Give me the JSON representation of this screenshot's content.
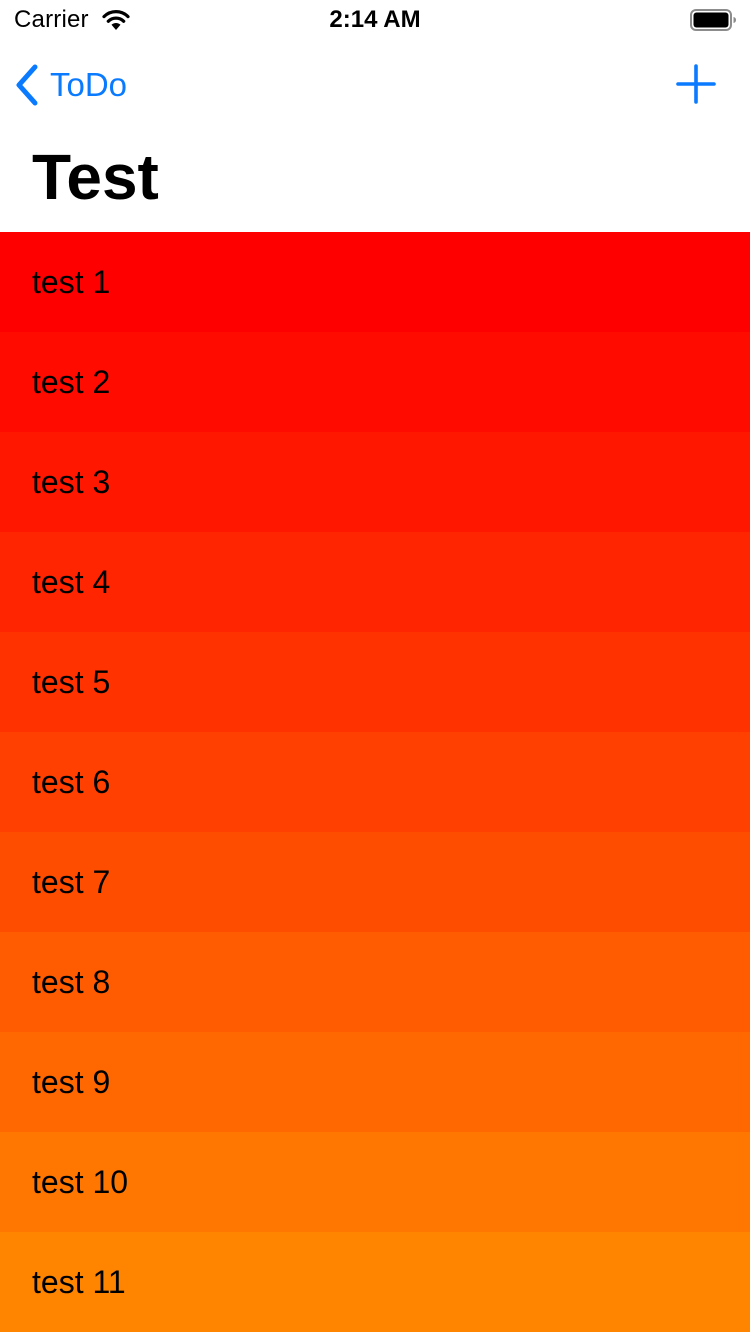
{
  "status_bar": {
    "carrier": "Carrier",
    "time": "2:14 AM"
  },
  "nav": {
    "back_label": "ToDo",
    "back_icon": "chevron-left-icon",
    "add_icon": "plus-icon",
    "accent_color": "#0a7aff"
  },
  "title": "Test",
  "items": [
    {
      "label": "test 1",
      "color": "#ff0000"
    },
    {
      "label": "test 2",
      "color": "#ff0b00"
    },
    {
      "label": "test 3",
      "color": "#ff1700"
    },
    {
      "label": "test 4",
      "color": "#ff2500"
    },
    {
      "label": "test 5",
      "color": "#ff3200"
    },
    {
      "label": "test 6",
      "color": "#ff4000"
    },
    {
      "label": "test 7",
      "color": "#ff4d00"
    },
    {
      "label": "test 8",
      "color": "#ff5b00"
    },
    {
      "label": "test 9",
      "color": "#ff6700"
    },
    {
      "label": "test 10",
      "color": "#ff7700"
    },
    {
      "label": "test 11",
      "color": "#ff8500"
    }
  ]
}
